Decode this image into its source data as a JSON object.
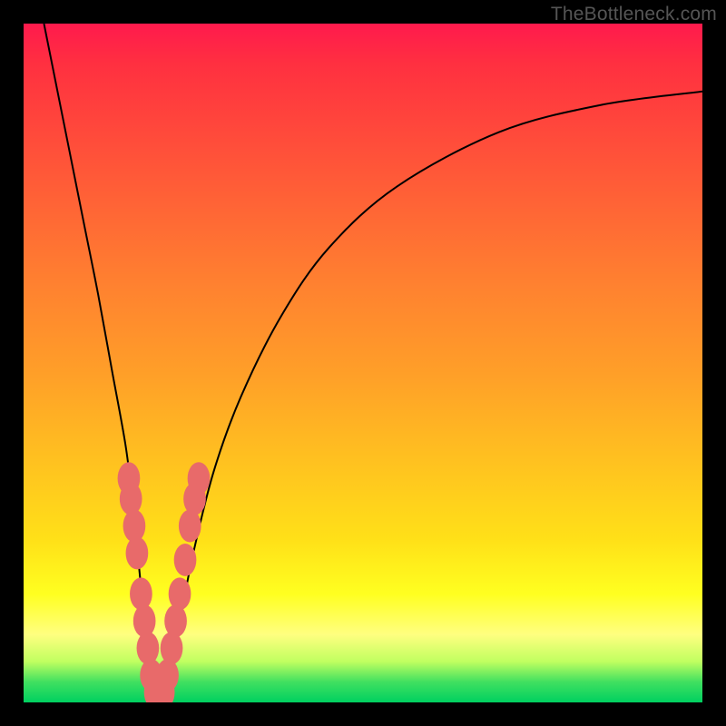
{
  "watermark": "TheBottleneck.com",
  "colors": {
    "frame": "#000000",
    "gradient_top": "#ff1a4d",
    "gradient_mid": "#ffe018",
    "gradient_bottom": "#00d060",
    "curve": "#000000",
    "markers": "#e86a6a"
  },
  "chart_data": {
    "type": "line",
    "title": "",
    "xlabel": "",
    "ylabel": "",
    "xlim": [
      0,
      100
    ],
    "ylim": [
      0,
      100
    ],
    "grid": false,
    "series": [
      {
        "name": "bottleneck-curve",
        "x": [
          3,
          5,
          7,
          9,
          11,
          13,
          15,
          16,
          17,
          18,
          19,
          20,
          21,
          23,
          25,
          28,
          32,
          38,
          45,
          55,
          70,
          85,
          100
        ],
        "y": [
          100,
          90,
          80,
          70,
          60,
          49,
          38,
          30,
          20,
          10,
          3,
          0,
          3,
          12,
          22,
          34,
          45,
          57,
          67,
          76,
          84,
          88,
          90
        ]
      }
    ],
    "markers": [
      {
        "x": 15.5,
        "y": 33,
        "r": 2.2
      },
      {
        "x": 15.8,
        "y": 30,
        "r": 2.2
      },
      {
        "x": 16.3,
        "y": 26,
        "r": 2.2
      },
      {
        "x": 16.7,
        "y": 22,
        "r": 2.2
      },
      {
        "x": 17.3,
        "y": 16,
        "r": 2.2
      },
      {
        "x": 17.8,
        "y": 12,
        "r": 2.2
      },
      {
        "x": 18.3,
        "y": 8,
        "r": 2.2
      },
      {
        "x": 18.8,
        "y": 4,
        "r": 2.2
      },
      {
        "x": 19.5,
        "y": 1.5,
        "r": 2.4
      },
      {
        "x": 20.5,
        "y": 1.5,
        "r": 2.4
      },
      {
        "x": 21.2,
        "y": 4,
        "r": 2.2
      },
      {
        "x": 21.8,
        "y": 8,
        "r": 2.2
      },
      {
        "x": 22.4,
        "y": 12,
        "r": 2.2
      },
      {
        "x": 23.0,
        "y": 16,
        "r": 2.2
      },
      {
        "x": 23.8,
        "y": 21,
        "r": 2.2
      },
      {
        "x": 24.5,
        "y": 26,
        "r": 2.2
      },
      {
        "x": 25.2,
        "y": 30,
        "r": 2.2
      },
      {
        "x": 25.8,
        "y": 33,
        "r": 2.2
      }
    ],
    "notes": "No axis ticks or labels are visible. x/y are expressed as 0–100 percent of plot width/height measured from bottom-left. Values estimated from pixel positions."
  }
}
